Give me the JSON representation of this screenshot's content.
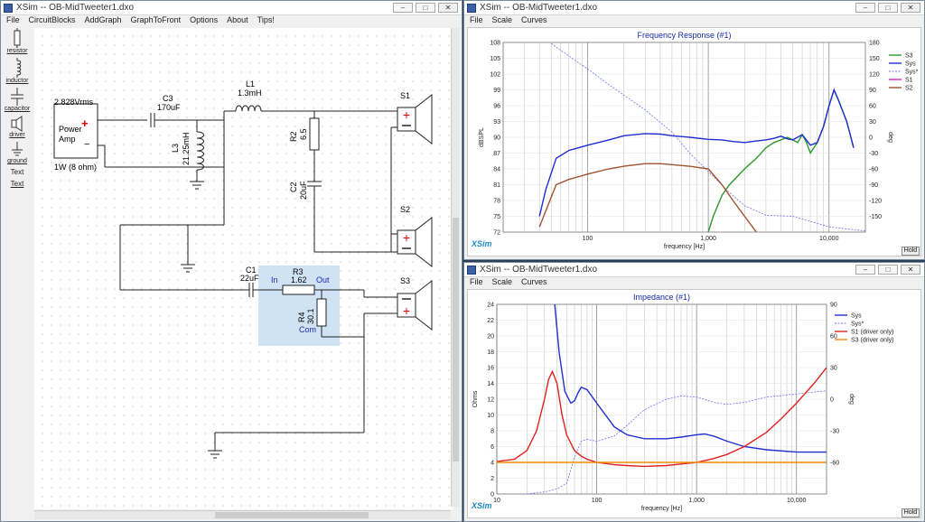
{
  "schematic_window": {
    "title": "XSim -- OB-MidTweeter1.dxo",
    "menu": [
      "File",
      "CircuitBlocks",
      "AddGraph",
      "GraphToFront",
      "Options",
      "About",
      "Tips!"
    ],
    "tools": [
      {
        "label": "resistor",
        "icon": "resistor-icon"
      },
      {
        "label": "inductor",
        "icon": "inductor-icon"
      },
      {
        "label": "capacitor",
        "icon": "capacitor-icon"
      },
      {
        "label": "driver",
        "icon": "driver-icon"
      },
      {
        "label": "ground",
        "icon": "ground-icon"
      },
      {
        "label": "Text",
        "icon": "text-tool"
      },
      {
        "label": "Text",
        "icon": "text-tool-underlined"
      }
    ],
    "amp": {
      "voltage": "2.828Vrms",
      "line1": "Power",
      "line2": "Amp",
      "plus": "+",
      "minus": "−",
      "power": "1W (8 ohm)"
    },
    "components": {
      "c3": {
        "name": "C3",
        "value": "170uF"
      },
      "l1": {
        "name": "L1",
        "value": "1.3mH"
      },
      "l3": {
        "name": "L3",
        "value": "21.25mH"
      },
      "r2": {
        "name": "R2",
        "value": "6.5"
      },
      "c2": {
        "name": "C2",
        "value": "20uF"
      },
      "c1": {
        "name": "C1",
        "value": "22uF"
      },
      "r3": {
        "name": "R3",
        "value": "1.62"
      },
      "r4": {
        "name": "R4",
        "value": "30.1"
      },
      "block": {
        "in": "In",
        "out": "Out",
        "com": "Com"
      }
    },
    "drivers": [
      "S1",
      "S2",
      "S3"
    ]
  },
  "freq_window": {
    "title": "XSim -- OB-MidTweeter1.dxo",
    "menu": [
      "File",
      "Scale",
      "Curves"
    ],
    "hold": "Hold",
    "brand": "XSim",
    "chart_data": {
      "type": "line",
      "title": "Frequency Response (#1)",
      "xlabel": "frequency [Hz]",
      "ylabel": "dBSPL",
      "y2label": "deg",
      "x_scale": "log",
      "xlim": [
        20,
        20000
      ],
      "ylim": [
        72,
        108
      ],
      "y2lim": [
        -180,
        180
      ],
      "x_ticks": [
        "100",
        "1,000",
        "10,000"
      ],
      "y_ticks": [
        "108",
        "105",
        "102",
        "99",
        "96",
        "93",
        "90",
        "87",
        "84",
        "81",
        "78",
        "75",
        "72"
      ],
      "y2_ticks": [
        "180",
        "150",
        "120",
        "90",
        "60",
        "30",
        "0",
        "-30",
        "-60",
        "-90",
        "-120",
        "-150"
      ],
      "grid": true,
      "legend_position": "right",
      "series": [
        {
          "name": "S3",
          "color": "#2a9a2a",
          "style": "solid",
          "axis": "left",
          "x": [
            1000,
            1100,
            1300,
            1500,
            2000,
            2500,
            3000,
            3500,
            4000,
            4500,
            5000,
            5500,
            6000,
            6500,
            7000,
            8000,
            9000,
            10000,
            11000,
            12000,
            14000,
            16000
          ],
          "y": [
            72,
            75,
            79,
            81,
            84,
            86,
            88,
            89,
            89.5,
            90,
            89.5,
            89,
            90.5,
            89,
            87,
            89,
            92,
            96,
            99,
            97,
            93,
            88
          ]
        },
        {
          "name": "Sys",
          "color": "#1f2fd0",
          "style": "solid",
          "axis": "left",
          "x": [
            40,
            45,
            55,
            70,
            100,
            150,
            200,
            300,
            400,
            500,
            700,
            1000,
            1300,
            1600,
            2000,
            2500,
            3000,
            3500,
            4000,
            4500,
            5000,
            6000,
            7000,
            8000,
            9000,
            10000,
            11000,
            12000,
            14000,
            16000
          ],
          "y": [
            75,
            80,
            86,
            87.5,
            88.5,
            89.5,
            90.3,
            90.7,
            90.6,
            90.3,
            90,
            89.6,
            89.5,
            89.2,
            89,
            89.3,
            89.5,
            89.8,
            90.2,
            89.7,
            89.5,
            90.5,
            88.5,
            89,
            92,
            96,
            99,
            97,
            93,
            88
          ]
        },
        {
          "name": "Sys*",
          "color": "#6e6ef0",
          "style": "dashed",
          "axis": "right",
          "x": [
            50,
            60,
            80,
            100,
            150,
            200,
            300,
            500,
            700,
            1000,
            1500,
            2000,
            3000,
            5000,
            10000,
            20000
          ],
          "y": [
            178,
            165,
            145,
            130,
            100,
            80,
            52,
            10,
            -30,
            -65,
            -105,
            -130,
            -148,
            -150,
            -170,
            -178
          ]
        },
        {
          "name": "S1",
          "color": "#d020d0",
          "style": "solid",
          "axis": "left",
          "x": [],
          "y": []
        },
        {
          "name": "S2",
          "color": "#a0522d",
          "style": "solid",
          "axis": "left",
          "x": [
            40,
            45,
            55,
            70,
            100,
            150,
            200,
            300,
            400,
            500,
            700,
            1000,
            1300,
            1600,
            2000,
            2500
          ],
          "y": [
            73,
            76,
            81,
            82,
            83,
            84,
            84.5,
            85,
            85,
            84.8,
            84.5,
            84,
            81,
            78,
            75,
            72
          ]
        }
      ]
    }
  },
  "imp_window": {
    "title": "XSim -- OB-MidTweeter1.dxo",
    "menu": [
      "File",
      "Scale",
      "Curves"
    ],
    "hold": "Hold",
    "brand": "XSim",
    "chart_data": {
      "type": "line",
      "title": "Impedance (#1)",
      "xlabel": "frequency [Hz]",
      "ylabel": "Ohms",
      "y2label": "deg",
      "x_scale": "log",
      "xlim": [
        10,
        20000
      ],
      "ylim": [
        0,
        24
      ],
      "y2lim": [
        -90,
        90
      ],
      "x_ticks": [
        "10",
        "100",
        "1,000",
        "10,000"
      ],
      "y_ticks": [
        "24",
        "22",
        "20",
        "18",
        "16",
        "14",
        "12",
        "10",
        "8",
        "6",
        "4",
        "2",
        "0"
      ],
      "y2_ticks": [
        "90",
        "60",
        "30",
        "0",
        "-30",
        "-60"
      ],
      "grid": true,
      "legend_position": "top-right",
      "series": [
        {
          "name": "Sys",
          "color": "#1f2fd0",
          "style": "solid",
          "axis": "left",
          "x": [
            38,
            42,
            48,
            55,
            60,
            65,
            70,
            80,
            100,
            150,
            200,
            300,
            500,
            700,
            1000,
            1200,
            1500,
            2000,
            3000,
            5000,
            10000,
            20000
          ],
          "y": [
            24,
            18,
            13,
            11.5,
            11.8,
            12.8,
            13.5,
            13.2,
            11.5,
            8.5,
            7.5,
            7,
            7,
            7.2,
            7.5,
            7.6,
            7.3,
            6.7,
            6,
            5.6,
            5.3,
            5.3
          ]
        },
        {
          "name": "Sys*",
          "color": "#6e6ef0",
          "style": "dashed",
          "axis": "right",
          "x": [
            20,
            30,
            40,
            50,
            60,
            70,
            80,
            100,
            150,
            200,
            300,
            500,
            700,
            1000,
            1500,
            2000,
            3000,
            5000,
            10000,
            20000
          ],
          "y": [
            -90,
            -88,
            -85,
            -80,
            -55,
            -40,
            -38,
            -40,
            -35,
            -25,
            -10,
            0,
            3,
            2,
            -3,
            -5,
            -3,
            2,
            5,
            8
          ]
        },
        {
          "name": "S1 (driver only)",
          "color": "#e02020",
          "style": "solid",
          "axis": "left",
          "x": [
            10,
            15,
            20,
            25,
            30,
            33,
            36,
            40,
            45,
            50,
            60,
            70,
            80,
            100,
            150,
            200,
            300,
            500,
            700,
            1000,
            1500,
            2000,
            3000,
            5000,
            7000,
            10000,
            15000,
            20000
          ],
          "y": [
            4.1,
            4.4,
            5.5,
            8,
            12,
            14.5,
            15.5,
            14,
            10,
            7.5,
            5.5,
            4.8,
            4.4,
            4,
            3.7,
            3.6,
            3.5,
            3.6,
            3.8,
            4,
            4.5,
            5,
            6,
            7.8,
            9.5,
            11.5,
            14,
            16
          ]
        },
        {
          "name": "S3 (driver only)",
          "color": "#f08c00",
          "style": "solid",
          "axis": "left",
          "x": [
            10,
            20000
          ],
          "y": [
            4,
            4
          ]
        }
      ]
    }
  }
}
